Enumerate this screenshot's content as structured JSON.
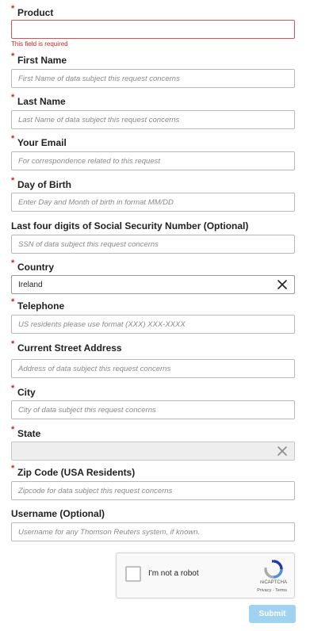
{
  "colors": {
    "required": "#c62828",
    "error_border": "#d9534f",
    "submit_bg": "#9fd3f1"
  },
  "required_marker": "*",
  "fields": {
    "product": {
      "label": "Product",
      "value": "",
      "error": "This field is required"
    },
    "first_name": {
      "label": "First Name",
      "placeholder": "First Name of data subject this request concerns"
    },
    "last_name": {
      "label": "Last Name",
      "placeholder": "Last Name of data subject this request concerns"
    },
    "email": {
      "label": "Your Email",
      "placeholder": "For correspondence related to this request"
    },
    "dob": {
      "label": "Day of Birth",
      "placeholder": "Enter Day and Month of birth in format MM/DD"
    },
    "ssn": {
      "label": "Last four digits of Social Security Number (Optional)",
      "placeholder": "SSN of data subject this request concerns"
    },
    "country": {
      "label": "Country",
      "value": "Ireland",
      "clear_icon": "close-icon"
    },
    "telephone": {
      "label": "Telephone",
      "placeholder": "US residents please use format (XXX) XXX-XXXX"
    },
    "street": {
      "label": "Current Street Address",
      "placeholder": "Address of data subject this request concerns"
    },
    "city": {
      "label": "City",
      "placeholder": "City of data subject this request concerns"
    },
    "state": {
      "label": "State",
      "value": "",
      "clear_icon": "close-icon"
    },
    "zip": {
      "label": "Zip Code (USA Residents)",
      "placeholder": "Zipcode for data subject this request concerns"
    },
    "username": {
      "label": "Username (Optional)",
      "placeholder": "Username for any Thomson Reuters system, if known."
    }
  },
  "captcha": {
    "label": "I'm not a robot",
    "brand": "reCAPTCHA",
    "links": "Privacy - Terms"
  },
  "submit_label": "Submit"
}
